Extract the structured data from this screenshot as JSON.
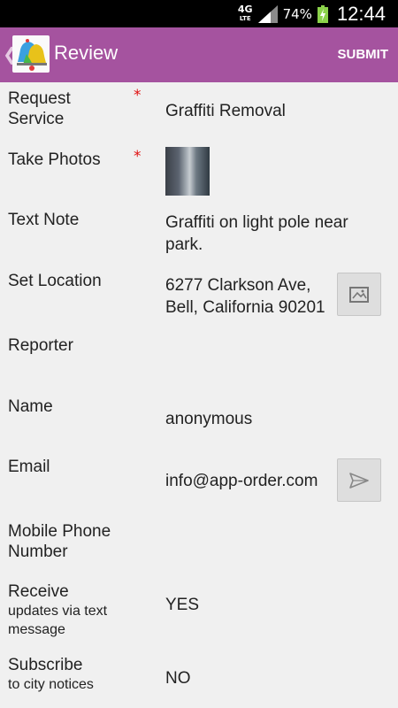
{
  "status_bar": {
    "network": "4G",
    "network_sub": "LTE",
    "battery": "74%",
    "time": "12:44"
  },
  "action_bar": {
    "back_glyph": "❮",
    "title": "Review",
    "submit_label": "SUBMIT",
    "app_icon": "bell-icon",
    "colors": {
      "bar": "#a5539f"
    }
  },
  "form": {
    "request_service": {
      "label": "Request Service",
      "required": "*",
      "value": "Graffiti Removal"
    },
    "take_photos": {
      "label": "Take Photos",
      "required": "*"
    },
    "text_note": {
      "label": "Text Note",
      "value": "Graffiti on light pole near park."
    },
    "set_location": {
      "label": "Set Location",
      "value": "6277 Clarkson Ave, Bell, California 90201",
      "button_icon": "map-icon"
    },
    "reporter": {
      "label": "Reporter"
    },
    "name": {
      "label": "Name",
      "value": "anonymous"
    },
    "email": {
      "label": "Email",
      "value": "info@app-order.com",
      "button_icon": "send-icon"
    },
    "mobile_phone": {
      "label": "Mobile Phone Number"
    },
    "receive_updates": {
      "label": "Receive",
      "sublabel": "updates via text message",
      "value": "YES"
    },
    "subscribe": {
      "label": "Subscribe",
      "sublabel": "to city notices",
      "value": "NO"
    }
  }
}
